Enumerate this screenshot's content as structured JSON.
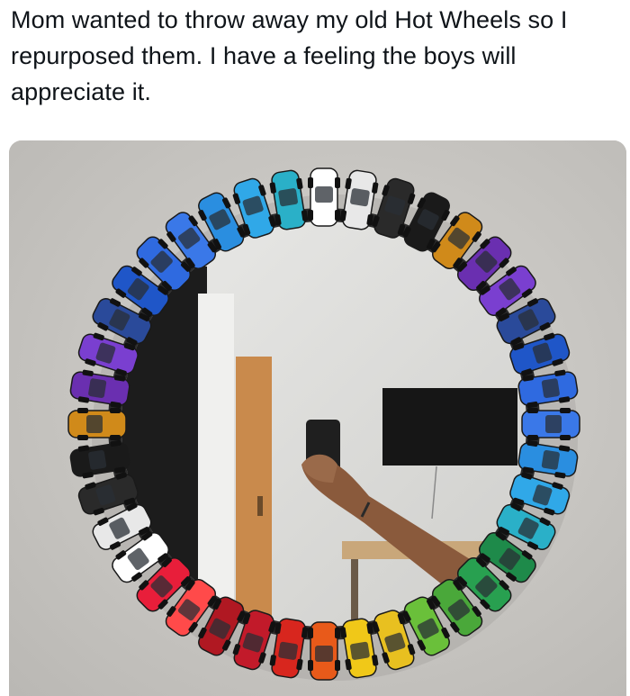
{
  "post": {
    "caption": "Mom wanted to throw away my old Hot Wheels so I repurposed them. I have a feeling the boys will appreciate it."
  },
  "photo": {
    "subject": "round mirror framed with toy cars",
    "car_colors": [
      "#ffffff",
      "#e8e8e8",
      "#2a2a2a",
      "#1a1a1a",
      "#d08a1a",
      "#6a2fb0",
      "#7a3fd0",
      "#2a4a9a",
      "#1f56c8",
      "#2f6ae0",
      "#3a78e8",
      "#2a8ee0",
      "#30a8e8",
      "#2ab0c8",
      "#1e8a4a",
      "#28a050",
      "#4aa83a",
      "#6ac03a",
      "#e8c020",
      "#f0c818",
      "#e85a1a",
      "#d8261e",
      "#c21a2a",
      "#b01822",
      "#ff4a4a",
      "#e81e3a"
    ]
  }
}
